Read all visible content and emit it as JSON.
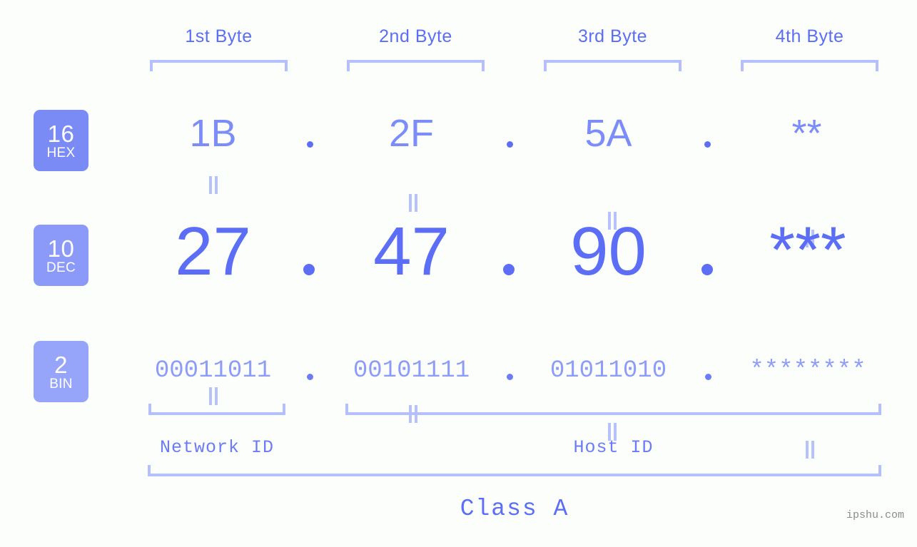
{
  "background_color": "#fcfefb",
  "colors": {
    "accent_strong": "#5b6ef5",
    "accent_mid": "#7c8cf8",
    "accent_light": "#8e9cf9",
    "bracket": "#b5bffb",
    "equals": "#b7c1fb",
    "badge_hex": "#7b8bf6",
    "badge_dec": "#8b99f8",
    "badge_bin": "#96a5f9",
    "watermark": "#8b8b8b"
  },
  "byte_headers": [
    {
      "label": "1st Byte"
    },
    {
      "label": "2nd Byte"
    },
    {
      "label": "3rd Byte"
    },
    {
      "label": "4th Byte"
    }
  ],
  "bases": [
    {
      "number": "16",
      "name": "HEX"
    },
    {
      "number": "10",
      "name": "DEC"
    },
    {
      "number": "2",
      "name": "BIN"
    }
  ],
  "rows": {
    "hex": {
      "values": [
        "1B",
        "2F",
        "5A",
        "**"
      ],
      "separator": "."
    },
    "dec": {
      "values": [
        "27",
        "47",
        "90",
        "***"
      ],
      "separator": "."
    },
    "binary": {
      "values": [
        "00011011",
        "00101111",
        "01011010",
        "********"
      ],
      "separator": "."
    }
  },
  "equals_symbol": "=",
  "segments": {
    "network_id": "Network ID",
    "host_id": "Host ID"
  },
  "class_label": "Class A",
  "watermark": "ipshu.com"
}
